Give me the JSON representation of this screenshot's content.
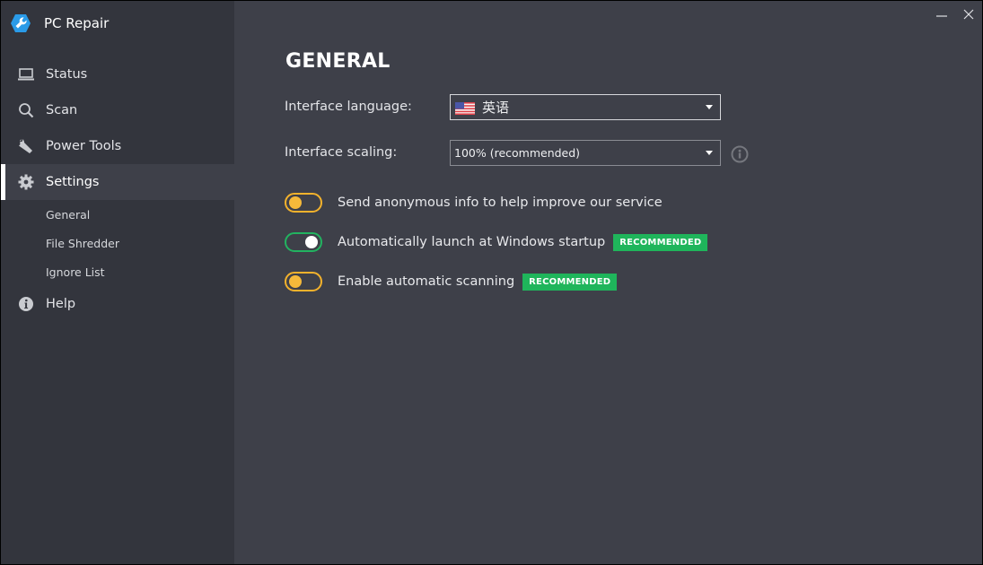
{
  "app": {
    "title": "PC Repair",
    "logo_icon": "wrench-hexagon-logo-icon"
  },
  "window_controls": {
    "minimize_icon": "minimize-icon",
    "close_icon": "close-icon"
  },
  "sidebar": {
    "items": [
      {
        "label": "Status",
        "icon": "laptop-icon",
        "active": false
      },
      {
        "label": "Scan",
        "icon": "search-icon",
        "active": false
      },
      {
        "label": "Power Tools",
        "icon": "wrench-icon",
        "active": false
      },
      {
        "label": "Settings",
        "icon": "gear-icon",
        "active": true
      },
      {
        "label": "Help",
        "icon": "info-icon",
        "active": false
      }
    ],
    "settings_subitems": [
      "General",
      "File Shredder",
      "Ignore List"
    ]
  },
  "main": {
    "title": "GENERAL",
    "language": {
      "label": "Interface language:",
      "value": "英语",
      "flag": "us-flag-icon"
    },
    "scaling": {
      "label": "Interface scaling:",
      "value": "100% (recommended)",
      "info_icon": "info-circle-icon"
    },
    "toggles": [
      {
        "label": "Send anonymous info to help improve our service",
        "on": false,
        "badge": null
      },
      {
        "label": "Automatically launch at Windows startup",
        "on": true,
        "badge": "RECOMMENDED"
      },
      {
        "label": "Enable automatic scanning",
        "on": false,
        "badge": "RECOMMENDED"
      }
    ]
  },
  "colors": {
    "sidebar_bg": "#33353d",
    "main_bg": "#3e4049",
    "toggle_off": "#f3b22c",
    "toggle_on": "#22b360",
    "badge": "#1fb55b"
  }
}
